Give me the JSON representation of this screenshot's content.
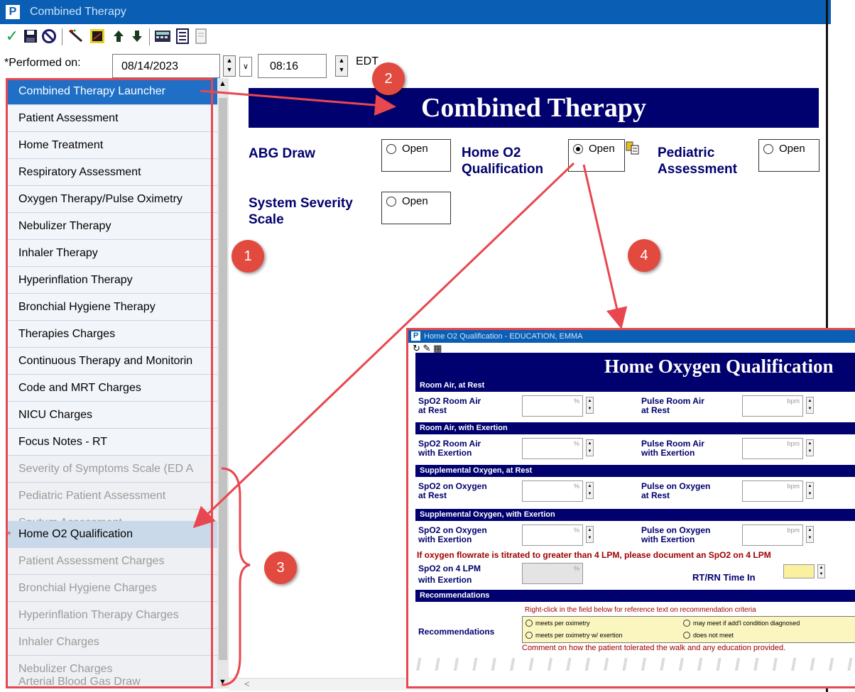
{
  "window": {
    "app_icon": "P",
    "title": "Combined Therapy"
  },
  "toolbar": {
    "icons": [
      "checkmark-icon",
      "save-icon",
      "cancel-icon",
      "wand-icon",
      "chart-icon",
      "up-arrow-icon",
      "down-arrow-icon",
      "calculator-icon",
      "notes-icon",
      "document-icon"
    ]
  },
  "performed": {
    "label": "*Performed on:",
    "date": "08/14/2023",
    "time": "08:16",
    "timezone": "EDT"
  },
  "nav": {
    "items": [
      "Combined Therapy Launcher",
      "Patient Assessment",
      "Home Treatment",
      "Respiratory Assessment",
      "Oxygen Therapy/Pulse Oximetry",
      "Nebulizer Therapy",
      "Inhaler Therapy",
      "Hyperinflation Therapy",
      "Bronchial Hygiene Therapy",
      "Therapies Charges",
      "Continuous Therapy and Monitorin",
      "Code and MRT Charges",
      "NICU Charges",
      "Focus Notes - RT",
      "Severity of Symptoms Scale (ED A",
      "Pediatric Patient Assessment",
      "Sputum Assessment",
      "Home O2 Qualification",
      "Patient Assessment Charges",
      "Bronchial Hygiene Charges",
      "Hyperinflation Therapy Charges",
      "Inhaler Charges",
      "Nebulizer Charges",
      "Arterial Blood Gas Draw"
    ],
    "required_marker": "*"
  },
  "main": {
    "banner": "Combined Therapy",
    "abg_label": "ABG Draw",
    "home_o2_label_1": "Home O2",
    "home_o2_label_2": "Qualification",
    "pediatric_label_1": "Pediatric",
    "pediatric_label_2": "Assessment",
    "severity_label_1": "System Severity",
    "severity_label_2": "Scale",
    "open": "Open"
  },
  "callouts": {
    "c1": "1",
    "c2": "2",
    "c3": "3",
    "c4": "4"
  },
  "popup": {
    "title": "Home O2 Qualification - EDUCATION, EMMA",
    "icon": "P",
    "banner": "Home Oxygen Qualification",
    "sections": {
      "s1": "Room Air, at Rest",
      "s2": "Room Air, with Exertion",
      "s3": "Supplemental Oxygen, at Rest",
      "s4": "Supplemental Oxygen, with Exertion",
      "s5": "Recommendations"
    },
    "fields": {
      "f1a": "SpO2 Room Air",
      "f1b": "at Rest",
      "f2a": "Pulse Room Air",
      "f2b": "at Rest",
      "f3a": "SpO2 Room Air",
      "f3b": "with Exertion",
      "f4a": "Pulse Room Air",
      "f4b": "with Exertion",
      "f5a": "SpO2  on Oxygen",
      "f5b": "at Rest",
      "f6a": "Pulse on Oxygen",
      "f6b": "at Rest",
      "f7a": "SpO2 on Oxygen",
      "f7b": "with Exertion",
      "f8a": "Pulse on Oxygen",
      "f8b": "with Exertion",
      "f9a": "SpO2 on 4 LPM",
      "f9b": "with Exertion",
      "time_in": "RT/RN Time In",
      "rec_label": "Recommendations"
    },
    "unit_pct": "%",
    "unit_bpm": "bpm",
    "warning": "If oxygen flowrate is titrated to greater than 4 LPM, please document an SpO2 on 4 LPM",
    "hint": "Right-click in the field below for reference text on recommendation criteria",
    "options": {
      "o1": "meets per oximetry",
      "o2": "may meet if add'l condition diagnosed",
      "o3": "meets per oximetry w/ exertion",
      "o4": "does not meet"
    },
    "comment": "Comment on how the patient tolerated the walk and any education provided."
  },
  "colors": {
    "accent_red": "#e8474f",
    "navy": "#00006e",
    "title_blue": "#0a5fb4",
    "nav_active": "#1f6fc6"
  }
}
